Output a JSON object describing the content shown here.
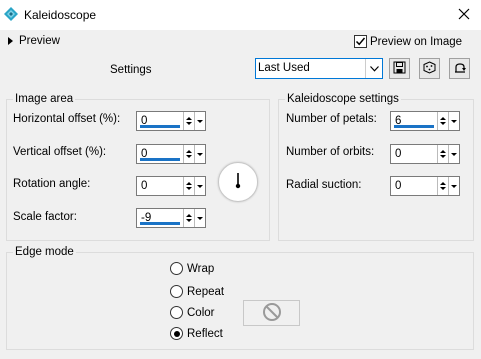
{
  "window": {
    "title": "Kaleidoscope",
    "close_icon": "close-icon",
    "app_icon": "kaleidoscope-app-icon"
  },
  "preview": {
    "toggle_label": "Preview",
    "preview_on_image_label": "Preview on Image",
    "preview_on_image_checked": true
  },
  "settings": {
    "label": "Settings",
    "preset_value": "Last Used",
    "tools": [
      "save-preset-icon",
      "randomize-icon",
      "reset-icon"
    ]
  },
  "image_area": {
    "title": "Image area",
    "fields": [
      {
        "label": "Horizontal offset (%):",
        "value": "0"
      },
      {
        "label": "Vertical offset (%):",
        "value": "0"
      },
      {
        "label": "Rotation angle:",
        "value": "0"
      },
      {
        "label": "Scale factor:",
        "value": "-9"
      }
    ]
  },
  "kaleidoscope_settings": {
    "title": "Kaleidoscope settings",
    "fields": [
      {
        "label": "Number of petals:",
        "value": "6"
      },
      {
        "label": "Number of orbits:",
        "value": "0"
      },
      {
        "label": "Radial suction:",
        "value": "0"
      }
    ]
  },
  "edge_mode": {
    "title": "Edge mode",
    "options": [
      {
        "label": "Wrap",
        "selected": false
      },
      {
        "label": "Repeat",
        "selected": false
      },
      {
        "label": "Color",
        "selected": false
      },
      {
        "label": "Reflect",
        "selected": true
      }
    ]
  },
  "colors": {
    "accent": "#0078d7",
    "spin_bar": "#1a73c6",
    "app_icon": "#2aa5c7"
  }
}
